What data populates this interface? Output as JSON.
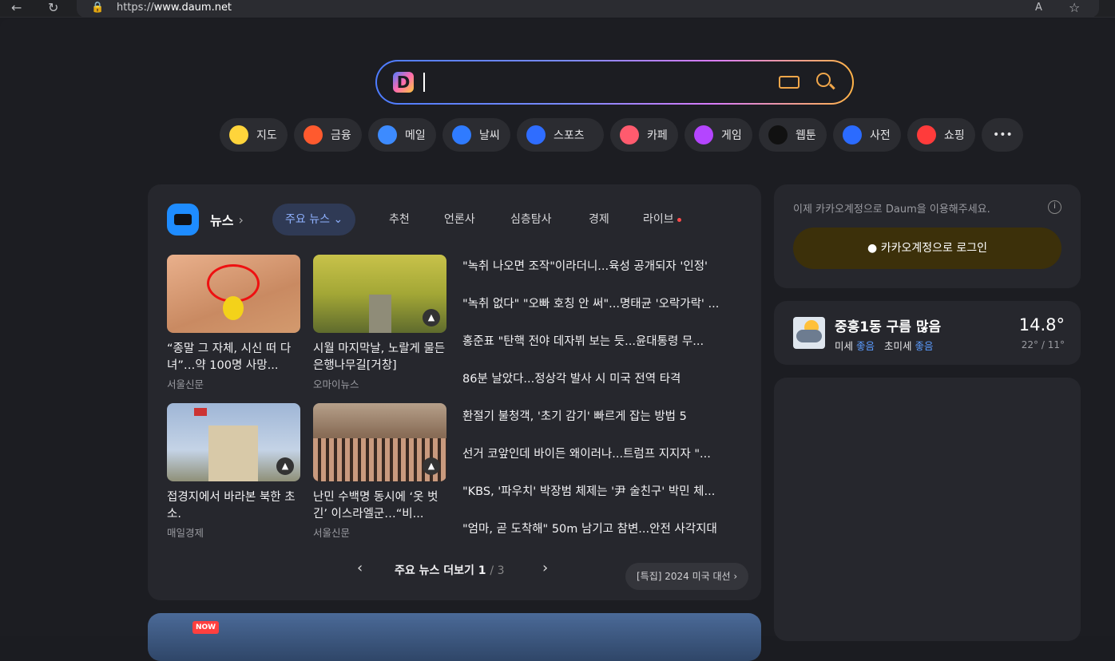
{
  "browser": {
    "url_prefix": "https://",
    "url_host": "www.daum.net"
  },
  "search": {
    "placeholder": "",
    "logo_letter": "D"
  },
  "chips": [
    {
      "label": "지도",
      "icon": "map-pin-icon",
      "color": "#ffd43b"
    },
    {
      "label": "금융",
      "icon": "finance-icon",
      "color": "#ff5a2e"
    },
    {
      "label": "메일",
      "icon": "mail-icon",
      "color": "#3d8bff"
    },
    {
      "label": "날씨",
      "icon": "weather-icon",
      "color": "#2f7bff"
    },
    {
      "label": "스포츠",
      "icon": "sports-icon",
      "color": "#2f6dff"
    },
    {
      "label": "카페",
      "icon": "cafe-icon",
      "color": "#ff5b6e"
    },
    {
      "label": "게임",
      "icon": "game-icon",
      "color": "#b445ff"
    },
    {
      "label": "웹툰",
      "icon": "webtoon-icon",
      "color": "#111111"
    },
    {
      "label": "사전",
      "icon": "dictionary-icon",
      "color": "#2b6bff"
    },
    {
      "label": "쇼핑",
      "icon": "shopping-icon",
      "color": "#ff3b3b"
    }
  ],
  "news": {
    "title": "뉴스",
    "tabs": [
      "주요 뉴스",
      "추천",
      "언론사",
      "심층탐사",
      "경제",
      "라이브"
    ],
    "cards": [
      {
        "caption": "“종말 그 자체, 시신 떠 다녀”…약 100명 사망...",
        "source": "서울신문"
      },
      {
        "caption": "시월 마지막날, 노랄게 물든 은행나무길[거창]",
        "source": "오마이뉴스"
      },
      {
        "caption": "접경지에서 바라본 북한 초소.",
        "source": "매일경제"
      },
      {
        "caption": "난민 수백명 동시에 ‘옷 벗긴’ 이스라엘군…“비...",
        "source": "서울신문"
      }
    ],
    "headlines": [
      "\"녹취 나오면 조작\"이라더니...육성 공개되자 '인정'",
      "\"녹취 없다\" \"오빠 호칭 안 써\"...명태균 '오락가락' ...",
      "홍준표 \"탄핵 전야 데자뷔 보는 듯...윤대통령 무...",
      "86분 날았다...정상각 발사 시 미국 전역 타격",
      "환절기 불청객, '초기 감기' 빠르게 잡는 방법 5",
      "선거 코앞인데 바이든 왜이러나...트럼프 지지자 \"...",
      "\"KBS, '파우치' 박장범 체제는 '尹 술친구' 박민 체...",
      "\"엄마, 곧 도착해\" 50m 남기고 참변...안전 사각지대"
    ],
    "more_label": "주요 뉴스 더보기",
    "page": "1",
    "total": "/ 3",
    "feature": "[특집] 2024 미국 대선"
  },
  "login": {
    "notice": "이제 카카오계정으로 Daum을 이용해주세요.",
    "button": "카카오계정으로 로그인"
  },
  "weather": {
    "location": "중흥1동 구름 많음",
    "dust_label": "미세",
    "dust": "좋음",
    "fine_label": "초미세",
    "fine": "좋음",
    "temp": "14.8°",
    "range": "22° / 11°"
  },
  "bottom": {
    "badge": "NOW"
  }
}
